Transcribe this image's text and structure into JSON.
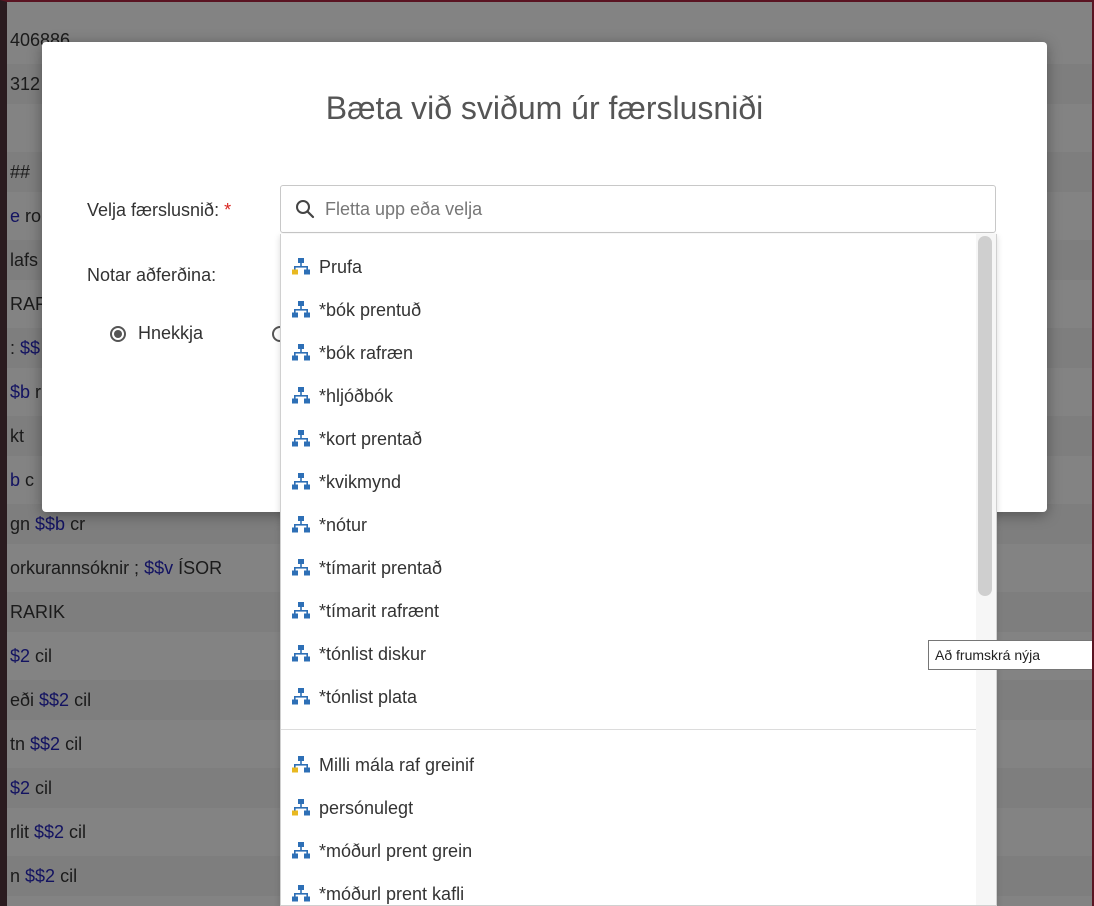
{
  "background_rows": [
    {
      "text": "406886",
      "sub": ""
    },
    {
      "text": "312",
      "sub": ""
    },
    {
      "text": "",
      "sub": ""
    },
    {
      "text": "##",
      "sub": ""
    },
    {
      "text": "",
      "sub": "e",
      "tail": " ro"
    },
    {
      "text": "lafs",
      "sub": ""
    },
    {
      "text": "RAF",
      "sub": ""
    },
    {
      "text": ": ",
      "sub": "$$"
    },
    {
      "text": "",
      "sub": "$b",
      "tail": " r"
    },
    {
      "text": "kt",
      "sub": ""
    },
    {
      "text": "",
      "sub": "b",
      "tail": " c"
    },
    {
      "text": "gn ",
      "sub": "$$b",
      "tail": " cr"
    },
    {
      "text": "orkurannsóknir ; ",
      "sub": "$$v",
      "tail": " ÍSOR"
    },
    {
      "text": " RARIK",
      "sub": ""
    },
    {
      "text": "",
      "sub": "$2",
      "tail": " cil"
    },
    {
      "text": "eði ",
      "sub": "$$2",
      "tail": " cil"
    },
    {
      "text": "tn ",
      "sub": "$$2",
      "tail": " cil"
    },
    {
      "text": "",
      "sub": "$2",
      "tail": " cil"
    },
    {
      "text": "rlit ",
      "sub": "$$2",
      "tail": " cil"
    },
    {
      "text": "n ",
      "sub": "$$2",
      "tail": " cil"
    }
  ],
  "modal": {
    "title": "Bæta við sviðum úr færslusniði",
    "template_label": "Velja færslusnið:",
    "required_mark": "*",
    "search_placeholder": "Fletta upp eða velja",
    "method_label": "Notar aðferðina:",
    "radio_option_1": "Hnekkja",
    "radio_option_1_checked": true
  },
  "dropdown": {
    "group1": [
      {
        "label": "Prufa",
        "icon": "template-icon-alt"
      },
      {
        "label": "*bók prentuð",
        "icon": "template-icon"
      },
      {
        "label": "*bók rafræn",
        "icon": "template-icon"
      },
      {
        "label": "*hljóðbók",
        "icon": "template-icon"
      },
      {
        "label": "*kort prentað",
        "icon": "template-icon"
      },
      {
        "label": "*kvikmynd",
        "icon": "template-icon"
      },
      {
        "label": "*nótur",
        "icon": "template-icon"
      },
      {
        "label": "*tímarit prentað",
        "icon": "template-icon"
      },
      {
        "label": "*tímarit rafrænt",
        "icon": "template-icon"
      },
      {
        "label": "*tónlist diskur",
        "icon": "template-icon"
      },
      {
        "label": "*tónlist plata",
        "icon": "template-icon"
      }
    ],
    "group2": [
      {
        "label": "Milli mála raf greinif",
        "icon": "template-icon-alt"
      },
      {
        "label": "persónulegt",
        "icon": "template-icon-alt"
      },
      {
        "label": "*móðurl prent grein",
        "icon": "template-icon"
      },
      {
        "label": "*móðurl prent kafli",
        "icon": "template-icon"
      }
    ]
  },
  "tooltip": "Að frumskrá nýja",
  "colors": {
    "icon_blue": "#2d6fb6",
    "icon_yellow": "#e8b820",
    "required": "#d9231f",
    "subfield": "#2424b4"
  }
}
